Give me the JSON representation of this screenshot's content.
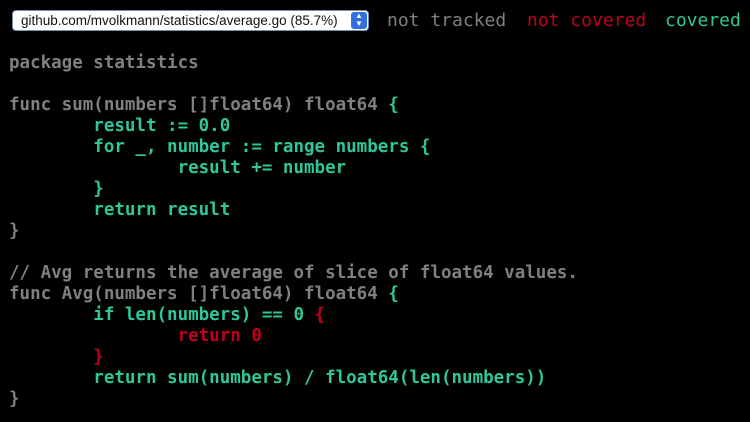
{
  "toolbar": {
    "file_selected": "github.com/mvolkmann/statistics/average.go (85.7%)",
    "arrow_up": "▲",
    "arrow_down": "▼"
  },
  "legend": {
    "not_tracked": "not tracked",
    "not_covered": "not covered",
    "covered": "covered"
  },
  "colors": {
    "not_tracked": "#808080",
    "not_covered": "#c0001a",
    "covered": "#2ec79a",
    "background": "#000000"
  },
  "code": {
    "lines": [
      [
        {
          "text": "package statistics",
          "status": "nt"
        }
      ],
      [],
      [
        {
          "text": "func sum(numbers []float64) float64 ",
          "status": "nt"
        },
        {
          "text": "{",
          "status": "cv"
        }
      ],
      [
        {
          "text": "        result := 0.0",
          "status": "cv"
        }
      ],
      [
        {
          "text": "        for _, number := range numbers {",
          "status": "cv"
        }
      ],
      [
        {
          "text": "                result += number",
          "status": "cv"
        }
      ],
      [
        {
          "text": "        }",
          "status": "cv"
        }
      ],
      [
        {
          "text": "        return result",
          "status": "cv"
        }
      ],
      [
        {
          "text": "}",
          "status": "nt"
        }
      ],
      [],
      [
        {
          "text": "// Avg returns the average of slice of float64 values.",
          "status": "nt"
        }
      ],
      [
        {
          "text": "func Avg(numbers []float64) float64 ",
          "status": "nt"
        },
        {
          "text": "{",
          "status": "cv"
        }
      ],
      [
        {
          "text": "        if len(numbers) == 0 ",
          "status": "cv"
        },
        {
          "text": "{",
          "status": "nc"
        }
      ],
      [
        {
          "text": "                return 0",
          "status": "nc"
        }
      ],
      [
        {
          "text": "        }",
          "status": "nc"
        }
      ],
      [
        {
          "text": "        return sum(numbers) / float64(len(numbers))",
          "status": "cv"
        }
      ],
      [
        {
          "text": "}",
          "status": "nt"
        }
      ]
    ]
  }
}
